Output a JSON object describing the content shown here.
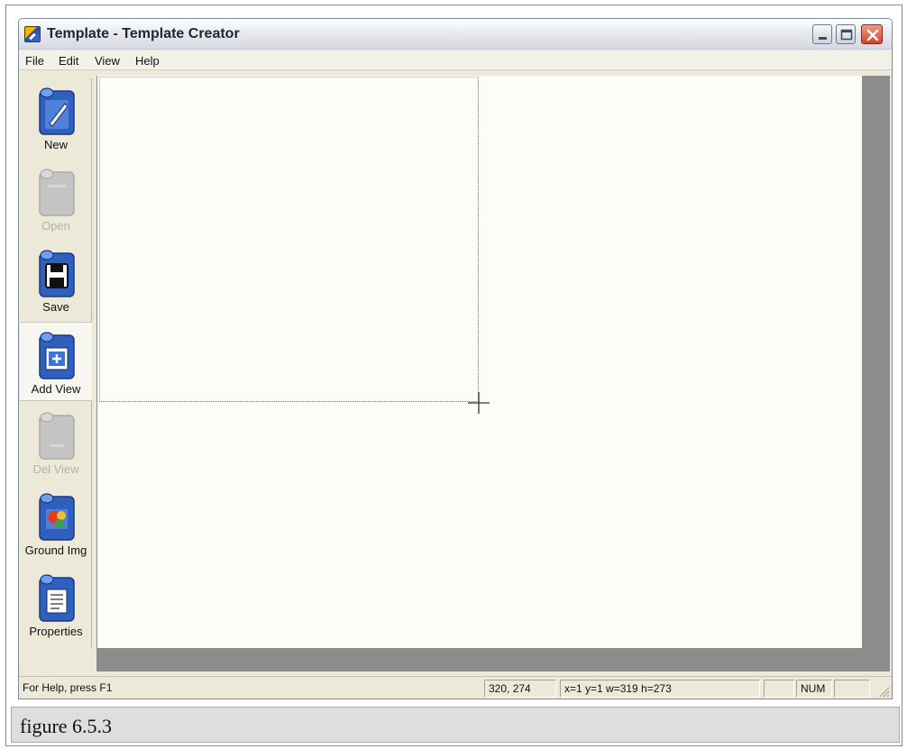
{
  "window": {
    "title": "Template - Template Creator"
  },
  "menu": [
    "File",
    "Edit",
    "View",
    "Help"
  ],
  "toolbar": {
    "items": [
      {
        "label": "New",
        "icon": "new-pencil-icon",
        "enabled": true
      },
      {
        "label": "Open",
        "icon": "open-icon",
        "enabled": false
      },
      {
        "label": "Save",
        "icon": "save-floppy-icon",
        "enabled": true
      },
      {
        "label": "Add View",
        "icon": "add-view-icon",
        "enabled": true,
        "active": true
      },
      {
        "label": "Del View",
        "icon": "delete-view-icon",
        "enabled": false
      },
      {
        "label": "Ground Img",
        "icon": "ground-image-icon",
        "enabled": true
      },
      {
        "label": "Properties",
        "icon": "properties-icon",
        "enabled": true
      }
    ]
  },
  "status": {
    "help": "For Help, press F1",
    "coords": "320, 274",
    "rect": "x=1 y=1 w=319 h=273",
    "num": "NUM"
  },
  "caption": "figure 6.5.3",
  "colors": {
    "window_bg": "#ece9d8",
    "canvas_bg": "#fdfdf8",
    "workspace_bg": "#8c8c8c",
    "icon_blue": "#2f5fbf",
    "close_red": "#d1452a"
  }
}
